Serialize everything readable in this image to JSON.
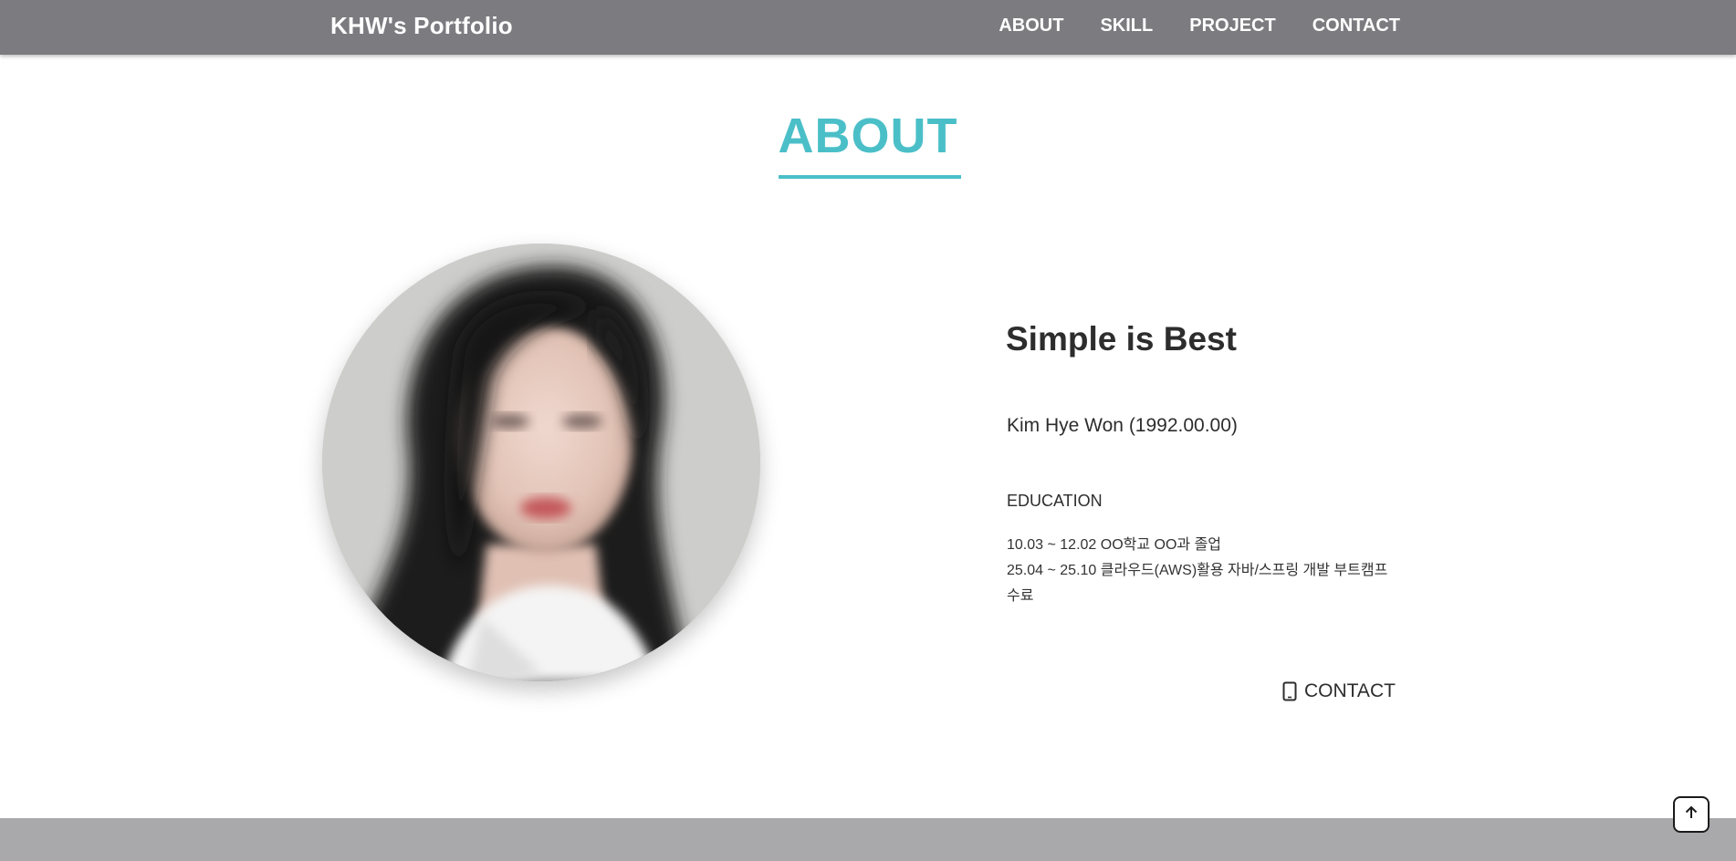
{
  "header": {
    "brand": "KHW's Portfolio",
    "nav": [
      {
        "label": "ABOUT"
      },
      {
        "label": "SKILL"
      },
      {
        "label": "PROJECT"
      },
      {
        "label": "CONTACT"
      }
    ]
  },
  "about": {
    "section_title": "ABOUT",
    "headline": "Simple is Best",
    "person": "Kim Hye Won (1992.00.00)",
    "education": {
      "title": "EDUCATION",
      "lines": [
        "10.03 ~ 12.02 OO학교 OO과 졸업",
        "25.04 ~ 25.10 클라우드(AWS)활용 자바/스프링 개발 부트캠프",
        "수료"
      ]
    },
    "contact_label": "CONTACT"
  },
  "icons": {
    "profile_photo": "profile-photo",
    "contact": "phone-icon",
    "scroll_top": "arrow-up-icon"
  },
  "colors": {
    "header_bg": "#7b7b80",
    "accent": "#4bbfc8",
    "footer_bg": "#a9a9ac",
    "text": "#2d2d2d"
  }
}
